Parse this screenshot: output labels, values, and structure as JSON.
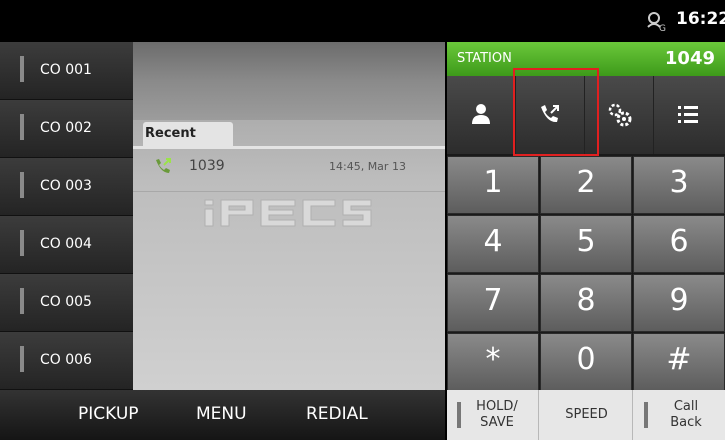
{
  "status_bar": {
    "time": "16:22",
    "icon": "network-g-icon"
  },
  "co_lines": [
    {
      "label": "CO 001"
    },
    {
      "label": "CO 002"
    },
    {
      "label": "CO 003"
    },
    {
      "label": "CO 004"
    },
    {
      "label": "CO 005"
    },
    {
      "label": "CO 006"
    }
  ],
  "recent": {
    "tab_label": "Recent",
    "entries": [
      {
        "number": "1039",
        "time": "14:45, Mar 13",
        "icon": "outgoing-call-icon"
      }
    ],
    "logo": "iPECS"
  },
  "station": {
    "label": "STATION",
    "number": "1049",
    "accent": "#4aa82a"
  },
  "function_buttons": [
    "contacts-icon",
    "call-log-icon",
    "settings-icon",
    "list-icon"
  ],
  "keypad": [
    "1",
    "2",
    "3",
    "4",
    "5",
    "6",
    "7",
    "8",
    "9",
    "*",
    "0",
    "#"
  ],
  "bottom_left": {
    "pickup": "PICKUP",
    "menu": "MENU",
    "redial": "REDIAL"
  },
  "bottom_right": {
    "hold_line1": "HOLD/",
    "hold_line2": "SAVE",
    "speed": "SPEED",
    "callback_line1": "Call",
    "callback_line2": "Back"
  },
  "highlight_color": "#e02020"
}
